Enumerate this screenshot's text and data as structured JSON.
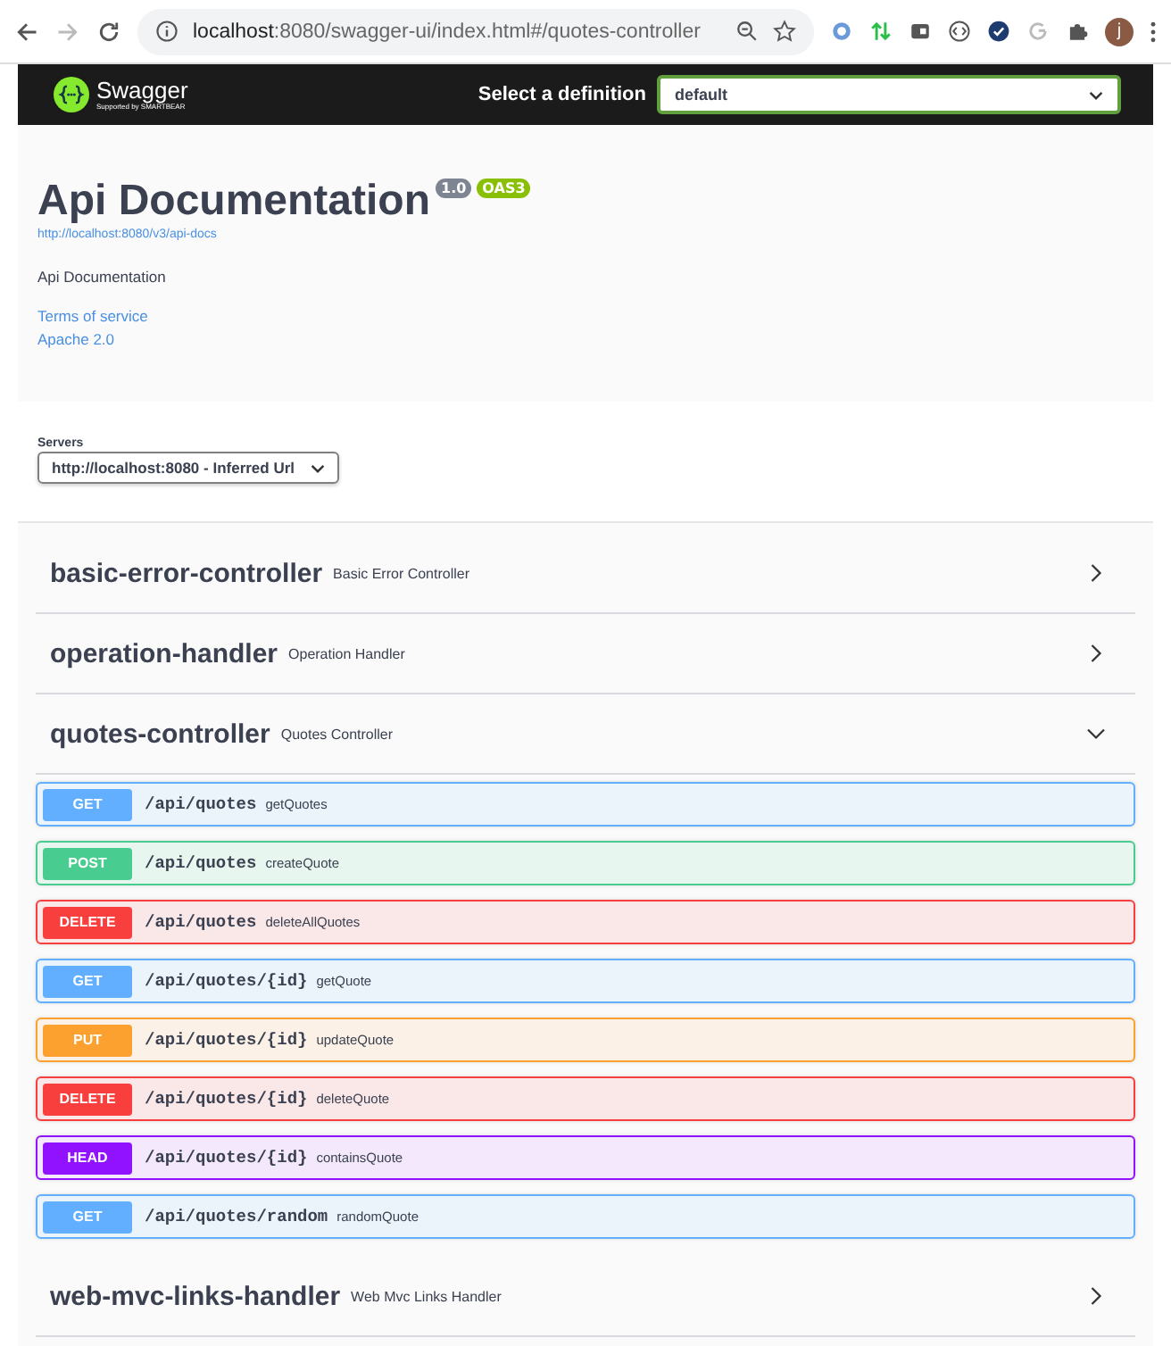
{
  "browser": {
    "url_host": "localhost",
    "url_rest": ":8080/swagger-ui/index.html#/quotes-controller",
    "forward_disabled": true,
    "profile_initial": "j"
  },
  "header": {
    "logo_text": "Swagger",
    "logo_sub": "Supported by SMARTBEAR",
    "definition_label": "Select a definition",
    "definition_value": "default"
  },
  "info": {
    "title": "Api Documentation",
    "version": "1.0",
    "oas": "OAS3",
    "spec_url": "http://localhost:8080/v3/api-docs",
    "description": "Api Documentation",
    "links": [
      "Terms of service",
      "Apache 2.0"
    ]
  },
  "servers": {
    "label": "Servers",
    "value": "http://localhost:8080 - Inferred Url"
  },
  "tags": [
    {
      "name": "basic-error-controller",
      "description": "Basic Error Controller",
      "expanded": false
    },
    {
      "name": "operation-handler",
      "description": "Operation Handler",
      "expanded": false
    },
    {
      "name": "quotes-controller",
      "description": "Quotes Controller",
      "expanded": true,
      "operations": [
        {
          "method": "GET",
          "path": "/api/quotes",
          "summary": "getQuotes"
        },
        {
          "method": "POST",
          "path": "/api/quotes",
          "summary": "createQuote"
        },
        {
          "method": "DELETE",
          "path": "/api/quotes",
          "summary": "deleteAllQuotes"
        },
        {
          "method": "GET",
          "path": "/api/quotes/{id}",
          "summary": "getQuote"
        },
        {
          "method": "PUT",
          "path": "/api/quotes/{id}",
          "summary": "updateQuote"
        },
        {
          "method": "DELETE",
          "path": "/api/quotes/{id}",
          "summary": "deleteQuote"
        },
        {
          "method": "HEAD",
          "path": "/api/quotes/{id}",
          "summary": "containsQuote"
        },
        {
          "method": "GET",
          "path": "/api/quotes/random",
          "summary": "randomQuote"
        }
      ]
    },
    {
      "name": "web-mvc-links-handler",
      "description": "Web Mvc Links Handler",
      "expanded": false
    }
  ]
}
